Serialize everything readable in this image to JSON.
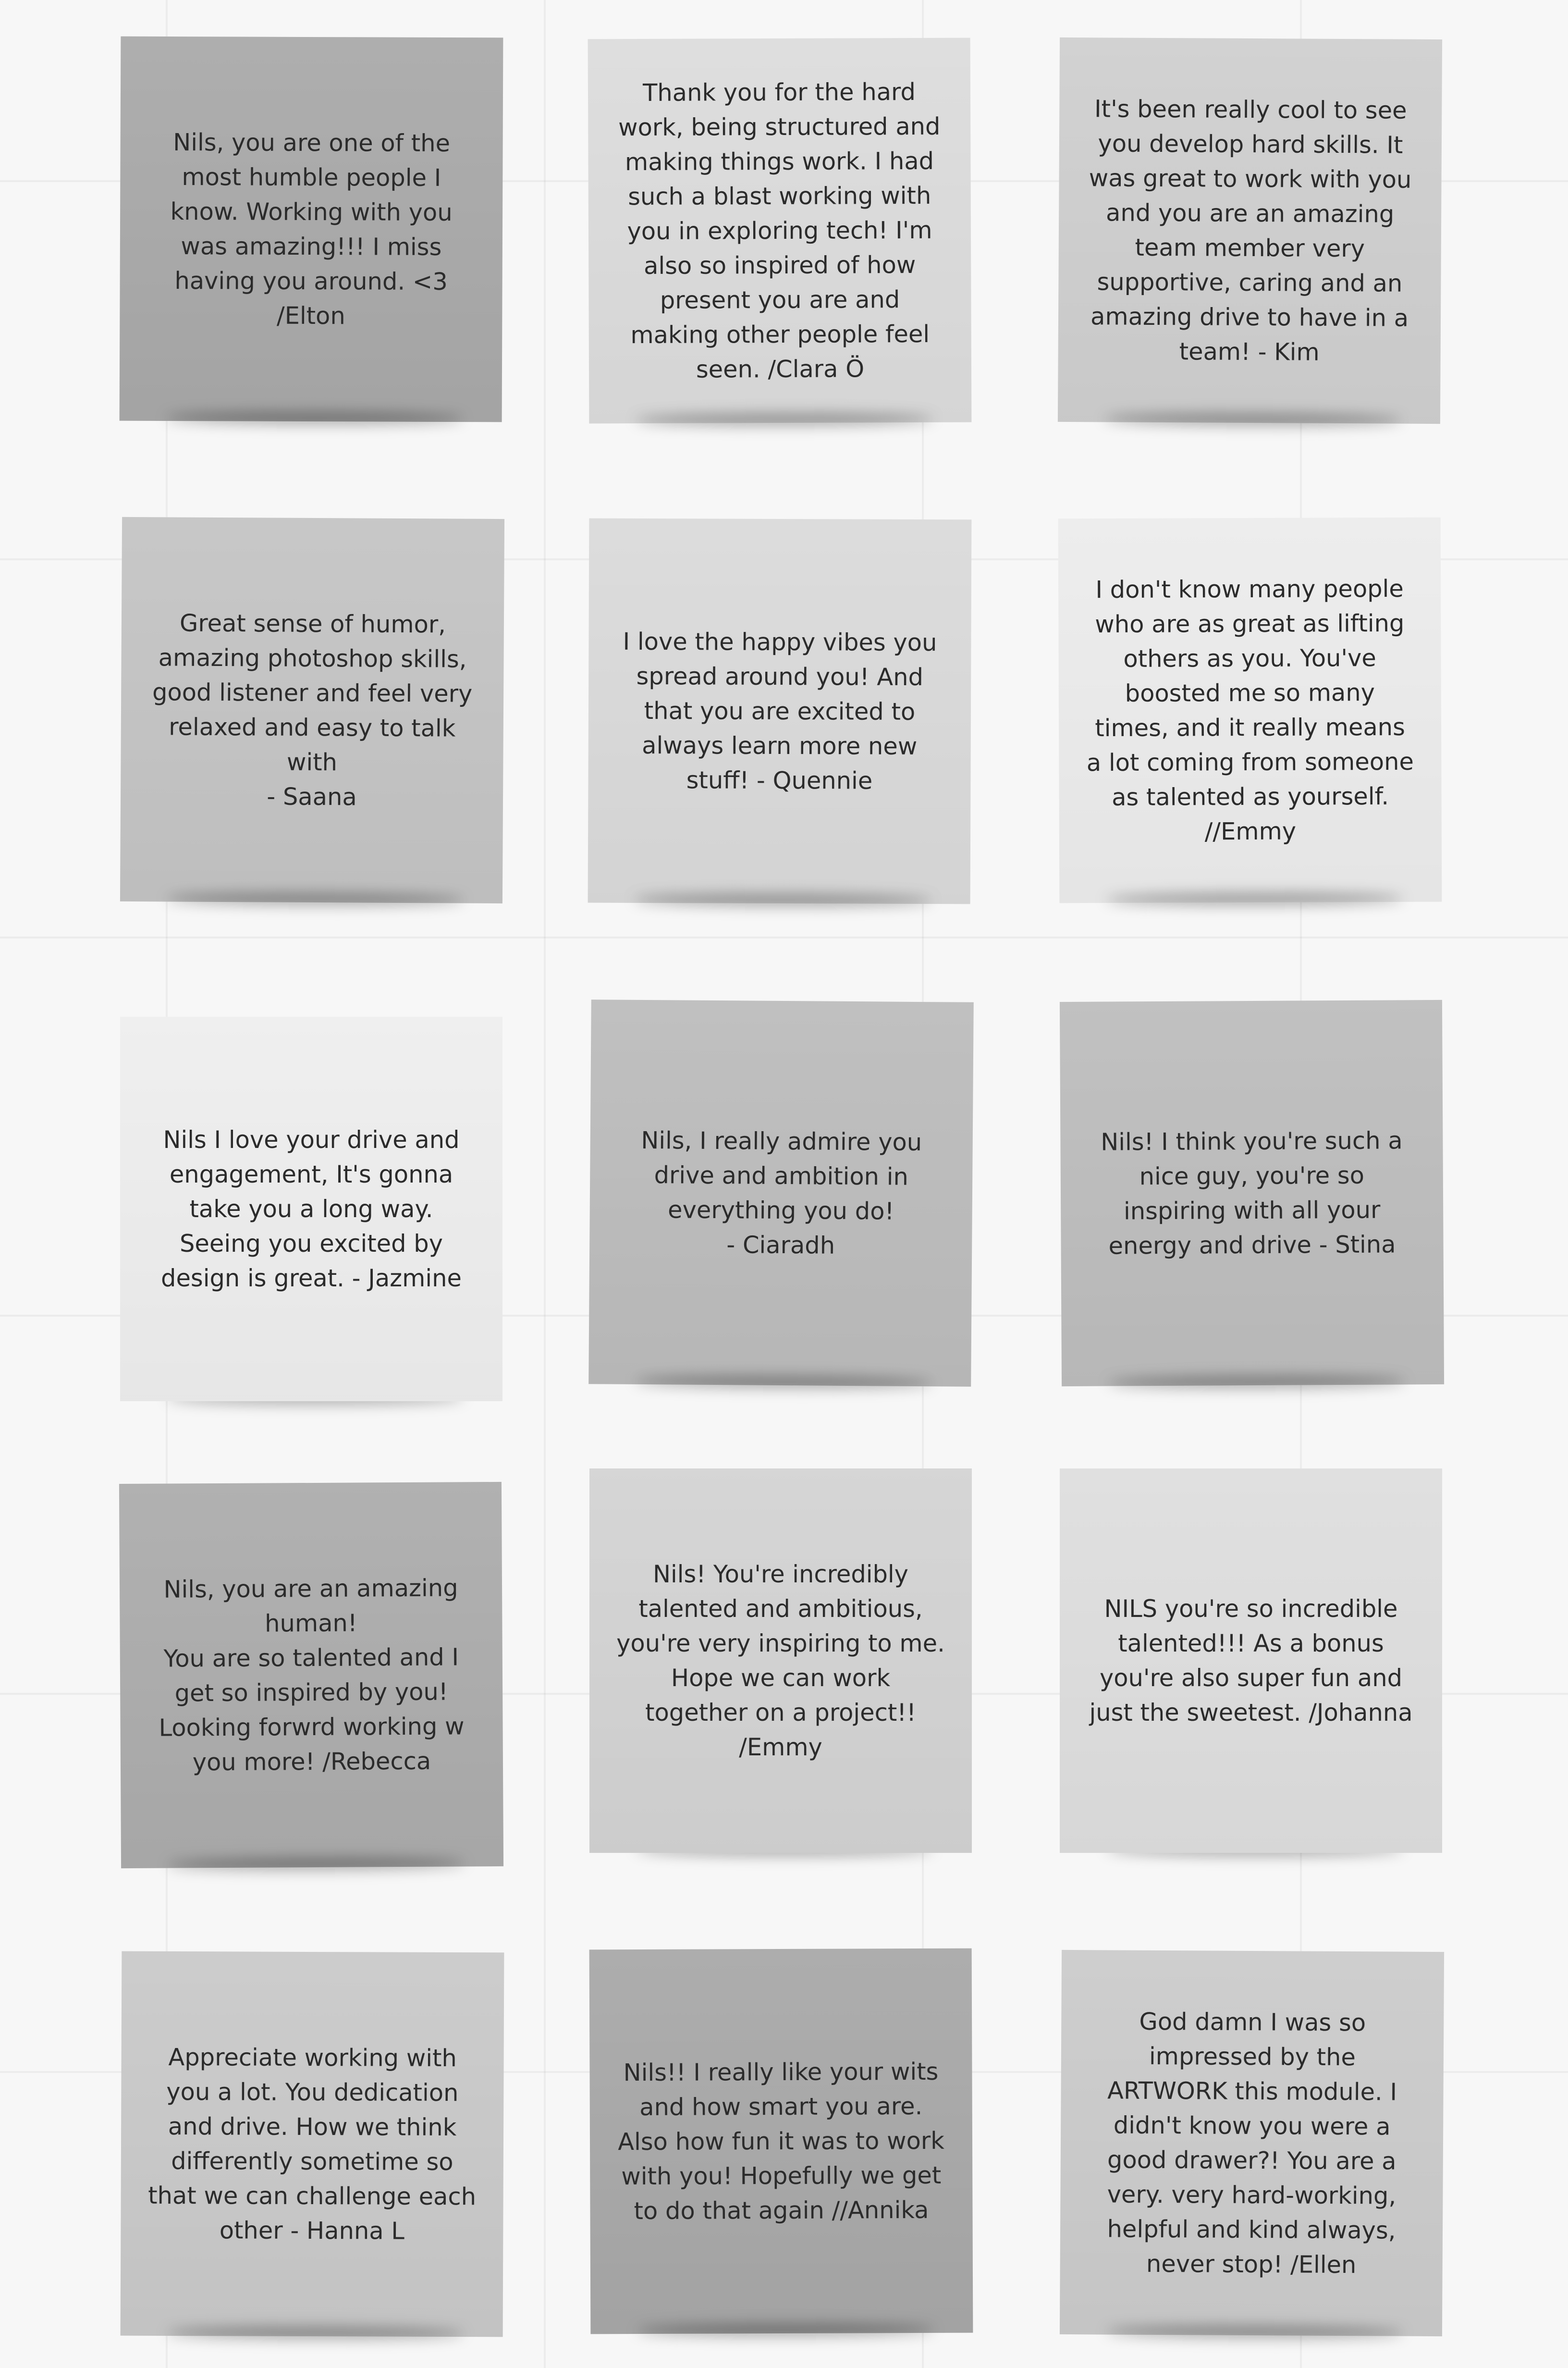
{
  "board": {
    "notes": [
      {
        "text": "Nils, you are one of the most humble people I know. Working with you was amazing!!! I miss having you around. <3\n/Elton",
        "color": "#a9a9a9"
      },
      {
        "text": "Thank you for the hard work,  being structured and making things work. I had such a blast working with you in exploring tech! I'm also so inspired of how present you are and making other people feel seen. /Clara Ö",
        "color": "#dcdcdc"
      },
      {
        "text": "It's been really cool to see you develop hard skills. It was great to work with you and you are an amazing team member very supportive, caring and an amazing drive to have in a team! - Kim",
        "color": "#cfcfcf"
      },
      {
        "text": "Great sense of humor, amazing photoshop skills, good listener and feel very relaxed and easy to talk with\n- Saana",
        "color": "#c4c4c4"
      },
      {
        "text": "I love the happy vibes you spread around you! And that you are excited to always learn more new stuff! - Quennie",
        "color": "#dadada"
      },
      {
        "text": "I don't know many people who are as great as lifting others as you. You've boosted me so many times, and it really means a lot coming from someone as talented as yourself.\n//Emmy",
        "color": "#ececec"
      },
      {
        "text": "Nils I love your drive and engagement, It's gonna take you a long way. Seeing you excited by design is great. - Jazmine",
        "color": "#eeeeee"
      },
      {
        "text": "Nils, I really admire you drive and ambition in everything you do!\n- Ciaradh",
        "color": "#bcbcbc"
      },
      {
        "text": "Nils! I think you're such a nice guy, you're so inspiring with all your energy and drive - Stina",
        "color": "#bdbdbd"
      },
      {
        "text": "Nils, you are an  amazing human!\nYou are so talented and I get so inspired by you! Looking forwrd working w you more! /Rebecca",
        "color": "#acacac"
      },
      {
        "text": "Nils! You're incredibly talented and ambitious, you're very inspiring to me. Hope we can work together on a project!! /Emmy",
        "color": "#d3d3d3"
      },
      {
        "text": "NILS you're so incredible talented!!! As a bonus you're also super fun and just the sweetest. /Johanna",
        "color": "#dedede"
      },
      {
        "text": "Appreciate working with you a lot. You dedication and drive. How we think differently sometime so that we can challenge each other - Hanna L",
        "color": "#c9c9c9"
      },
      {
        "text": "Nils!! I really like your wits and how smart you are. Also how fun it was to work with you! Hopefully we get to do that again //Annika",
        "color": "#a8a8a8"
      },
      {
        "text": "God damn I was so impressed by the ARTWORK  this module. I didn't know you were a good drawer?! You are a very. very hard-working, helpful and kind always, never stop! /Ellen",
        "color": "#cbcbcb"
      }
    ]
  }
}
